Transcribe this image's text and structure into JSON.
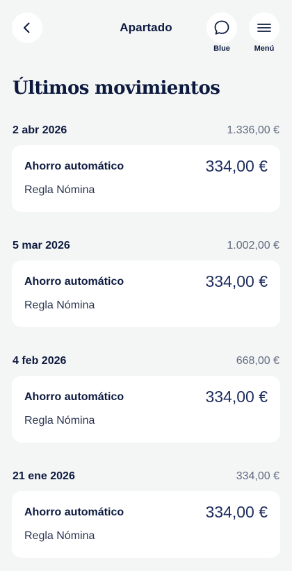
{
  "header": {
    "title": "Apartado",
    "blue_label": "Blue",
    "menu_label": "Menú",
    "icons": {
      "back": "chevron-left-icon",
      "blue": "chat-bubble-icon",
      "menu": "hamburger-menu-icon"
    }
  },
  "page": {
    "title": "Últimos movimientos"
  },
  "groups": [
    {
      "date": "2 abr 2026",
      "total": "1.336,00 €",
      "item": {
        "title": "Ahorro automático",
        "subtitle": "Regla Nómina",
        "amount": "334,00 €"
      }
    },
    {
      "date": "5 mar 2026",
      "total": "1.002,00 €",
      "item": {
        "title": "Ahorro automático",
        "subtitle": "Regla Nómina",
        "amount": "334,00 €"
      }
    },
    {
      "date": "4 feb 2026",
      "total": "668,00 €",
      "item": {
        "title": "Ahorro automático",
        "subtitle": "Regla Nómina",
        "amount": "334,00 €"
      }
    },
    {
      "date": "21 ene 2026",
      "total": "334,00 €",
      "item": {
        "title": "Ahorro automático",
        "subtitle": "Regla Nómina",
        "amount": "334,00 €"
      }
    }
  ],
  "colors": {
    "background": "#f4f6f6",
    "text": "#0d1a3f",
    "muted": "#616b80",
    "card": "#ffffff"
  }
}
